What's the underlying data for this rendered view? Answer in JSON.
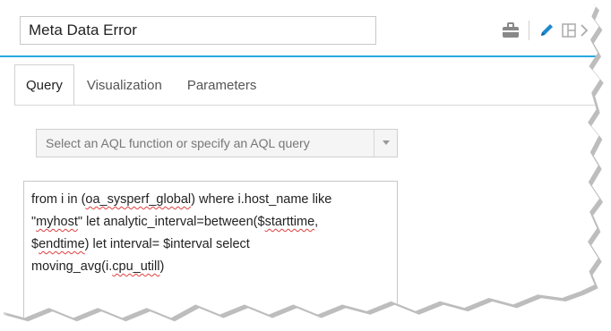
{
  "header": {
    "title_value": "Meta Data Error",
    "icons": [
      "briefcase-icon",
      "pencil-icon",
      "layout-icon",
      "chevron-right-icon"
    ]
  },
  "tabs": [
    {
      "label": "Query",
      "active": true
    },
    {
      "label": "Visualization",
      "active": false
    },
    {
      "label": "Parameters",
      "active": false
    }
  ],
  "aql_select": {
    "placeholder": "Select an AQL function or specify an AQL query"
  },
  "query": {
    "lines": [
      [
        "from i in (",
        "oa_sysperf_global",
        ") where i.host_name like"
      ],
      [
        "\"",
        "myhost",
        "\" let analytic_interval=between($",
        "starttime",
        ","
      ],
      [
        "$",
        "endtime",
        ") let interval= $interval select"
      ],
      [
        "moving_avg(i.",
        "cpu_utill",
        ")"
      ]
    ]
  },
  "colors": {
    "accent": "#29a9e0",
    "pencil": "#1e88d0",
    "misspell": "#e04040"
  }
}
